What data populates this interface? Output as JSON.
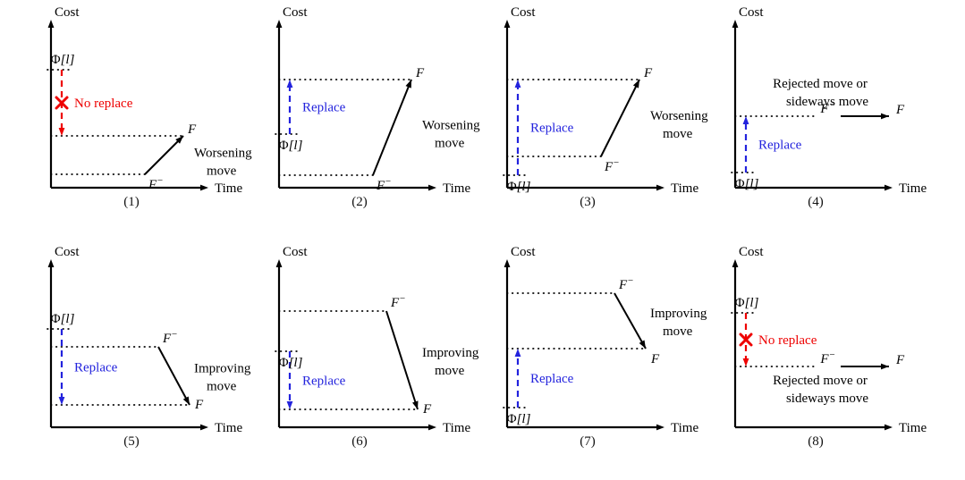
{
  "figure": {
    "axis_labels": {
      "y": "Cost",
      "x": "Time"
    },
    "symbols": {
      "phi": "Φ[l]",
      "f": "F",
      "f_minus": "F−"
    },
    "colors": {
      "replace": "#2323dd",
      "no_replace": "#ee0000",
      "ink": "#000000"
    }
  },
  "panels": [
    {
      "id": "panel-1",
      "caption": "(1)",
      "y_axis_label": "Cost",
      "x_axis_label": "Time",
      "phi_label": "Φ[l]",
      "f_label": "F",
      "f_minus_label": "F−",
      "decision_label": "No replace",
      "decision_type": "no-replace",
      "move_label_line1": "Worsening",
      "move_label_line2": "move",
      "move_type": "worsening",
      "phi_level": 78,
      "f_level": 152,
      "f_minus_level": 195,
      "arrow_direction": "down"
    },
    {
      "id": "panel-2",
      "caption": "(2)",
      "y_axis_label": "Cost",
      "x_axis_label": "Time",
      "phi_label": "Φ[l]",
      "f_label": "F",
      "f_minus_label": "F−",
      "decision_label": "Replace",
      "decision_type": "replace",
      "move_label_line1": "Worsening",
      "move_label_line2": "move",
      "move_type": "worsening",
      "phi_level": 150,
      "f_level": 89,
      "f_minus_level": 196,
      "arrow_direction": "up"
    },
    {
      "id": "panel-3",
      "caption": "(3)",
      "y_axis_label": "Cost",
      "x_axis_label": "Time",
      "phi_label": "Φ[l]",
      "f_label": "F",
      "f_minus_label": "F−",
      "decision_label": "Replace",
      "decision_type": "replace",
      "move_label_line1": "Worsening",
      "move_label_line2": "move",
      "move_type": "worsening",
      "phi_level": 196,
      "f_level": 89,
      "f_minus_level": 175,
      "arrow_direction": "up"
    },
    {
      "id": "panel-4",
      "caption": "(4)",
      "y_axis_label": "Cost",
      "x_axis_label": "Time",
      "phi_label": "Φ[l]",
      "f_label": "F",
      "f_minus_label": "F−",
      "decision_label": "Replace",
      "decision_type": "replace",
      "move_label_line1": "Rejected move or",
      "move_label_line2": "sideways move",
      "move_type": "sideways",
      "move_label_position": "above",
      "phi_level": 193,
      "f_level": 130,
      "f_minus_level": 130,
      "arrow_direction": "up"
    },
    {
      "id": "panel-5",
      "caption": "(5)",
      "y_axis_label": "Cost",
      "x_axis_label": "Time",
      "phi_label": "Φ[l]",
      "f_label": "F",
      "f_minus_label": "F−",
      "decision_label": "Replace",
      "decision_type": "replace",
      "move_label_line1": "Improving",
      "move_label_line2": "move",
      "move_type": "improving",
      "phi_level": 100,
      "f_level": 185,
      "f_minus_level": 120,
      "arrow_direction": "down"
    },
    {
      "id": "panel-6",
      "caption": "(6)",
      "y_axis_label": "Cost",
      "x_axis_label": "Time",
      "phi_label": "Φ[l]",
      "f_label": "F",
      "f_minus_label": "F−",
      "decision_label": "Replace",
      "decision_type": "replace",
      "move_label_line1": "Improving",
      "move_label_line2": "move",
      "move_type": "improving",
      "phi_level": 125,
      "f_level": 190,
      "f_minus_level": 80,
      "arrow_direction": "down"
    },
    {
      "id": "panel-7",
      "caption": "(7)",
      "y_axis_label": "Cost",
      "x_axis_label": "Time",
      "phi_label": "Φ[l]",
      "f_label": "F",
      "f_minus_label": "F−",
      "decision_label": "Replace",
      "decision_type": "replace",
      "move_label_line1": "Improving",
      "move_label_line2": "move",
      "move_type": "improving",
      "phi_level": 188,
      "f_level": 122,
      "f_minus_level": 60,
      "arrow_direction": "up"
    },
    {
      "id": "panel-8",
      "caption": "(8)",
      "y_axis_label": "Cost",
      "x_axis_label": "Time",
      "phi_label": "Φ[l]",
      "f_label": "F",
      "f_minus_label": "F−",
      "decision_label": "No replace",
      "decision_type": "no-replace",
      "move_label_line1": "Rejected move or",
      "move_label_line2": "sideways move",
      "move_type": "sideways",
      "move_label_position": "below",
      "phi_level": 82,
      "f_level": 142,
      "f_minus_level": 142,
      "arrow_direction": "down"
    }
  ]
}
